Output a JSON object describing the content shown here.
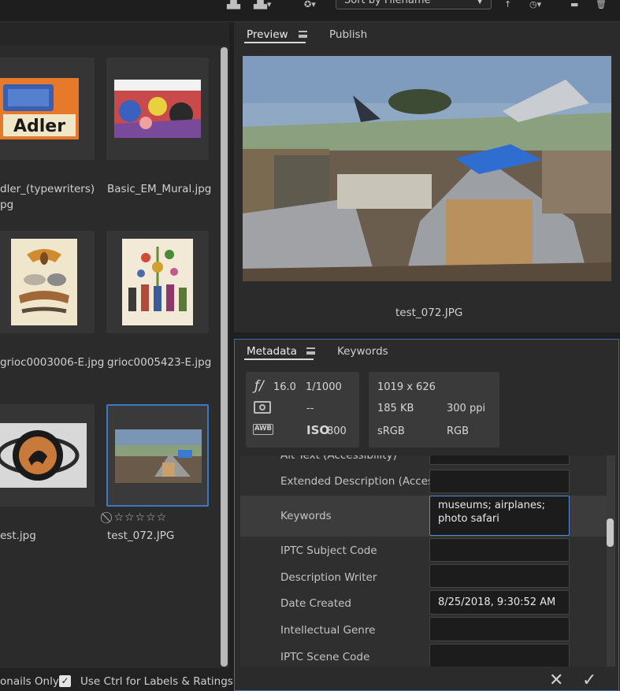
{
  "toolbar": {
    "sort_label": "Sort by Filename"
  },
  "grid": {
    "items": [
      {
        "label": "dler_(typewriters)",
        "label2": "pg"
      },
      {
        "label": "Basic_EM_Mural.jpg"
      },
      {
        "label": "grioc0003006-E.jpg"
      },
      {
        "label": "grioc0005423-E.jpg"
      },
      {
        "label": "est.jpg"
      },
      {
        "label": "test_072.JPG"
      }
    ],
    "rating_text": "⃠ ☆☆☆☆☆"
  },
  "bottom_bar": {
    "left_text": "onails Only",
    "checkbox_label": "Use Ctrl for Labels & Ratings",
    "checkbox_checked": true
  },
  "preview": {
    "tabs": [
      "Preview",
      "Publish"
    ],
    "caption": "test_072.JPG"
  },
  "metadata": {
    "tabs": [
      "Metadata",
      "Keywords"
    ],
    "exposure": {
      "aperture_symbol": "ƒ/",
      "aperture": "16.0",
      "shutter": "1/1000",
      "metering": "--",
      "iso_label": "ISO",
      "iso": "800",
      "awb": "AWB"
    },
    "file": {
      "dimensions": "1019 x 626",
      "size": "185 KB",
      "resolution": "300 ppi",
      "color_profile": "sRGB",
      "color_mode": "RGB"
    },
    "fields": [
      {
        "label": "Alt Text (Accessibility)",
        "value": ""
      },
      {
        "label": "Extended Description (Acces...",
        "value": ""
      },
      {
        "label": "Keywords",
        "value": "museums; airplanes; photo safari"
      },
      {
        "label": "IPTC Subject Code",
        "value": ""
      },
      {
        "label": "Description Writer",
        "value": ""
      },
      {
        "label": "Date Created",
        "value": "8/25/2018, 9:30:52 AM"
      },
      {
        "label": "Intellectual Genre",
        "value": ""
      },
      {
        "label": "IPTC Scene Code",
        "value": ""
      }
    ]
  },
  "actions": {
    "cancel_icon": "close-icon",
    "apply_icon": "checkmark-icon"
  },
  "colors": {
    "accent": "#3a78c8",
    "panel": "#2b2b2b",
    "background": "#1f1f1f"
  }
}
